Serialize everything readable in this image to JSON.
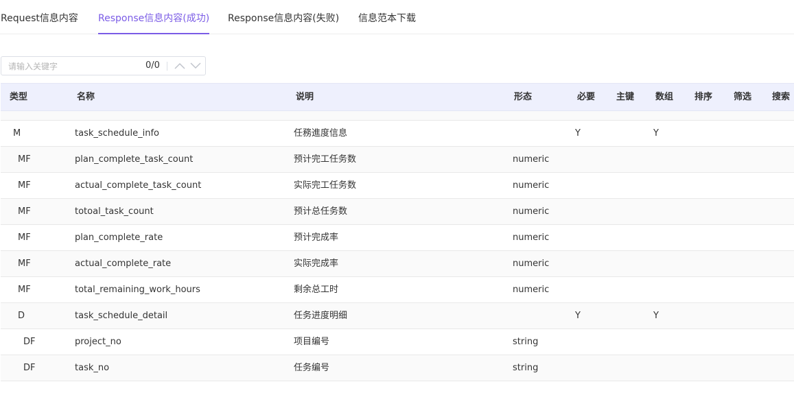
{
  "tabs": [
    {
      "label": "Request信息内容"
    },
    {
      "label": "Response信息内容(成功)"
    },
    {
      "label": "Response信息内容(失败)"
    },
    {
      "label": "信息范本下载"
    }
  ],
  "active_tab_color": "#7b5ce6",
  "search": {
    "placeholder": "请输入关键字",
    "count": "0/0"
  },
  "table": {
    "columns": [
      "类型",
      "名称",
      "说明",
      "形态",
      "必要",
      "主键",
      "数组",
      "排序",
      "筛选",
      "搜索"
    ],
    "rows": [
      {
        "type": "M",
        "name": "task_schedule_info",
        "desc": "任務進度信息",
        "form": "",
        "required": "Y",
        "primary": "",
        "array": "Y"
      },
      {
        "type": "MF",
        "name": "plan_complete_task_count",
        "desc": "预计完工任务数",
        "form": "numeric",
        "required": "",
        "primary": "",
        "array": ""
      },
      {
        "type": "MF",
        "name": "actual_complete_task_count",
        "desc": "实际完工任务数",
        "form": "numeric",
        "required": "",
        "primary": "",
        "array": ""
      },
      {
        "type": "MF",
        "name": "totoal_task_count",
        "desc": "预计总任务数",
        "form": "numeric",
        "required": "",
        "primary": "",
        "array": ""
      },
      {
        "type": "MF",
        "name": "plan_complete_rate",
        "desc": "预计完成率",
        "form": "numeric",
        "required": "",
        "primary": "",
        "array": ""
      },
      {
        "type": "MF",
        "name": "actual_complete_rate",
        "desc": "实际完成率",
        "form": "numeric",
        "required": "",
        "primary": "",
        "array": ""
      },
      {
        "type": "MF",
        "name": "total_remaining_work_hours",
        "desc": "剩余总工时",
        "form": "numeric",
        "required": "",
        "primary": "",
        "array": ""
      },
      {
        "type": "D",
        "name": "task_schedule_detail",
        "desc": "任务进度明细",
        "form": "",
        "required": "Y",
        "primary": "",
        "array": "Y"
      },
      {
        "type": "DF",
        "name": "project_no",
        "desc": "项目编号",
        "form": "string",
        "required": "",
        "primary": "",
        "array": ""
      },
      {
        "type": "DF",
        "name": "task_no",
        "desc": "任务编号",
        "form": "string",
        "required": "",
        "primary": "",
        "array": ""
      }
    ]
  }
}
